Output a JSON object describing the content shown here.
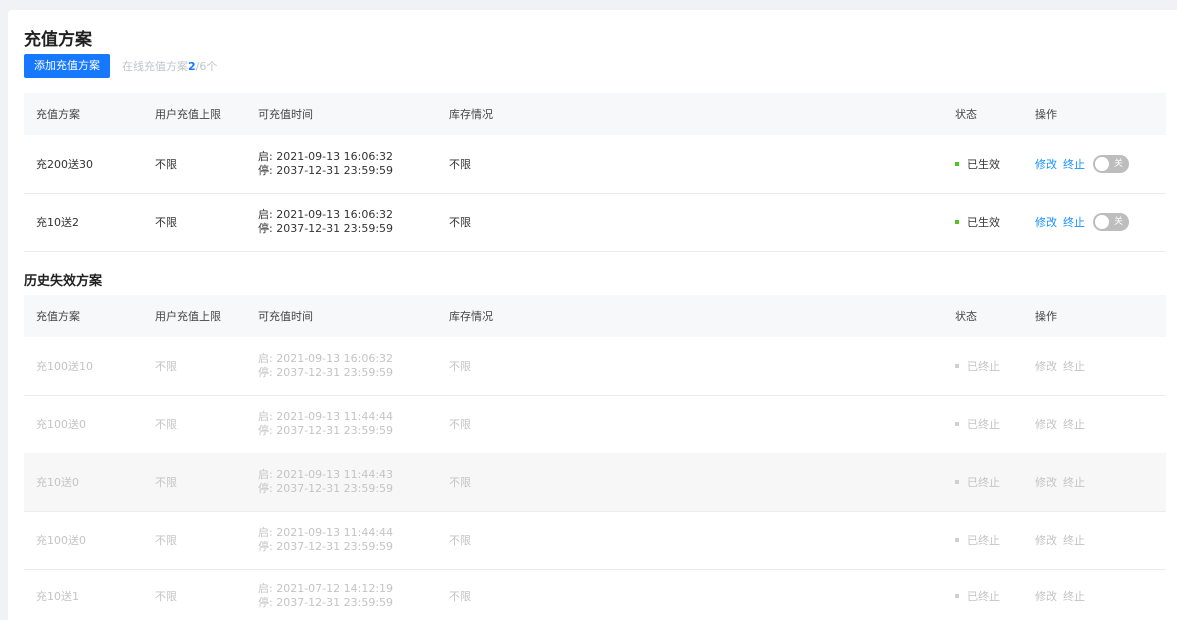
{
  "title": "充值方案",
  "toolbar": {
    "add_label": "添加充值方案",
    "online_label": "在线充值方案",
    "online_current": "2",
    "online_sep": "/",
    "online_total": "6个"
  },
  "columns": [
    "充值方案",
    "用户充值上限",
    "可充值时间",
    "库存情况",
    "状态",
    "操作"
  ],
  "active_rows": [
    {
      "name": "充200送30",
      "limit": "不限",
      "start": "启: 2021-09-13 16:06:32",
      "end": "停: 2037-12-31 23:59:59",
      "stock": "不限",
      "status": "已生效",
      "edit": "修改",
      "stop": "终止",
      "toggle": "关"
    },
    {
      "name": "充10送2",
      "limit": "不限",
      "start": "启: 2021-09-13 16:06:32",
      "end": "停: 2037-12-31 23:59:59",
      "stock": "不限",
      "status": "已生效",
      "edit": "修改",
      "stop": "终止",
      "toggle": "关"
    }
  ],
  "history_title": "历史失效方案",
  "history_rows": [
    {
      "name": "充100送10",
      "limit": "不限",
      "start": "启: 2021-09-13 16:06:32",
      "end": "停: 2037-12-31 23:59:59",
      "stock": "不限",
      "status": "已终止",
      "edit": "修改",
      "stop": "终止"
    },
    {
      "name": "充100送0",
      "limit": "不限",
      "start": "启: 2021-09-13 11:44:44",
      "end": "停: 2037-12-31 23:59:59",
      "stock": "不限",
      "status": "已终止",
      "edit": "修改",
      "stop": "终止"
    },
    {
      "name": "充10送0",
      "limit": "不限",
      "start": "启: 2021-09-13 11:44:43",
      "end": "停: 2037-12-31 23:59:59",
      "stock": "不限",
      "status": "已终止",
      "edit": "修改",
      "stop": "终止"
    },
    {
      "name": "充100送0",
      "limit": "不限",
      "start": "启: 2021-09-13 11:44:44",
      "end": "停: 2037-12-31 23:59:59",
      "stock": "不限",
      "status": "已终止",
      "edit": "修改",
      "stop": "终止"
    },
    {
      "name": "充10送1",
      "limit": "不限",
      "start": "启: 2021-07-12 14:12:19",
      "end": "停: 2037-12-31 23:59:59",
      "stock": "不限",
      "status": "已终止",
      "edit": "修改",
      "stop": "终止"
    }
  ],
  "colors": {
    "primary": "#1677ff",
    "active_dot": "#52c41a",
    "link": "#1890ff"
  }
}
